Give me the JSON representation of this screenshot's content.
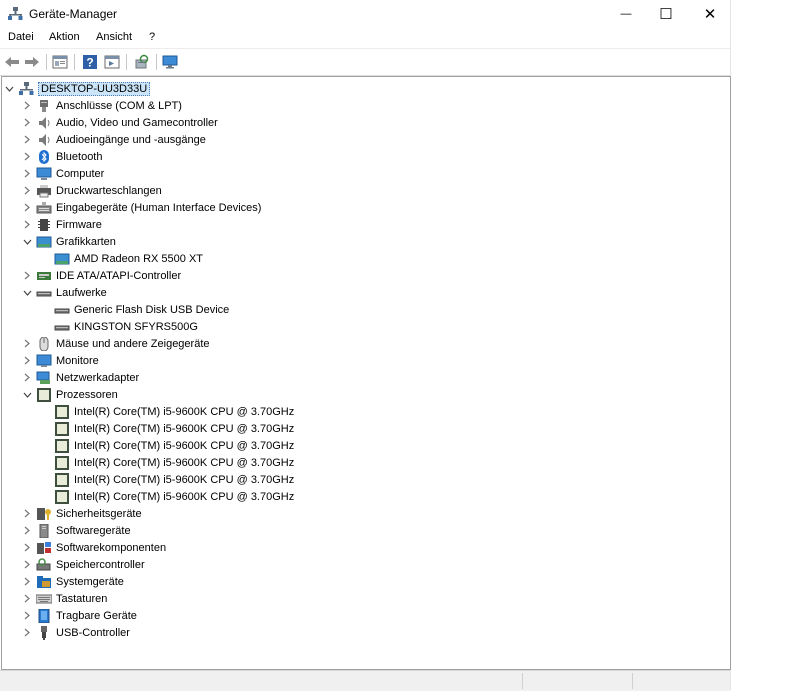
{
  "window": {
    "title": "Geräte-Manager",
    "minimize_glyph": "—",
    "maximize_glyph": "☐",
    "close_glyph": "✕"
  },
  "menu": [
    "Datei",
    "Aktion",
    "Ansicht",
    "?"
  ],
  "toolbar": [
    "back-arrow-icon",
    "forward-arrow-icon",
    "properties-icon",
    "help-icon",
    "view-icon",
    "scan-hardware-icon",
    "monitor-icon"
  ],
  "tree": {
    "root": "DESKTOP-UU3D33U",
    "categories": [
      {
        "label": "Anschlüsse (COM & LPT)",
        "icon": "port-icon",
        "expanded": false
      },
      {
        "label": "Audio, Video und Gamecontroller",
        "icon": "speaker-icon",
        "expanded": false
      },
      {
        "label": "Audioeingänge und -ausgänge",
        "icon": "speaker-icon",
        "expanded": false
      },
      {
        "label": "Bluetooth",
        "icon": "bluetooth-icon",
        "expanded": false
      },
      {
        "label": "Computer",
        "icon": "computer-icon",
        "expanded": false
      },
      {
        "label": "Druckwarteschlangen",
        "icon": "printer-icon",
        "expanded": false
      },
      {
        "label": "Eingabegeräte (Human Interface Devices)",
        "icon": "hid-icon",
        "expanded": false
      },
      {
        "label": "Firmware",
        "icon": "firmware-icon",
        "expanded": false
      },
      {
        "label": "Grafikkarten",
        "icon": "display-adapter-icon",
        "expanded": true,
        "children": [
          "AMD Radeon RX 5500 XT"
        ]
      },
      {
        "label": "IDE ATA/ATAPI-Controller",
        "icon": "ide-controller-icon",
        "expanded": false
      },
      {
        "label": "Laufwerke",
        "icon": "drive-icon",
        "expanded": true,
        "children": [
          "Generic Flash Disk USB Device",
          "KINGSTON SFYRS500G"
        ]
      },
      {
        "label": "Mäuse und andere Zeigegeräte",
        "icon": "mouse-icon",
        "expanded": false
      },
      {
        "label": "Monitore",
        "icon": "monitor-icon",
        "expanded": false
      },
      {
        "label": "Netzwerkadapter",
        "icon": "network-adapter-icon",
        "expanded": false
      },
      {
        "label": "Prozessoren",
        "icon": "cpu-icon",
        "expanded": true,
        "children": [
          "Intel(R) Core(TM) i5-9600K CPU @ 3.70GHz",
          "Intel(R) Core(TM) i5-9600K CPU @ 3.70GHz",
          "Intel(R) Core(TM) i5-9600K CPU @ 3.70GHz",
          "Intel(R) Core(TM) i5-9600K CPU @ 3.70GHz",
          "Intel(R) Core(TM) i5-9600K CPU @ 3.70GHz",
          "Intel(R) Core(TM) i5-9600K CPU @ 3.70GHz"
        ]
      },
      {
        "label": "Sicherheitsgeräte",
        "icon": "security-key-icon",
        "expanded": false
      },
      {
        "label": "Softwaregeräte",
        "icon": "software-device-icon",
        "expanded": false
      },
      {
        "label": "Softwarekomponenten",
        "icon": "software-component-icon",
        "expanded": false
      },
      {
        "label": "Speichercontroller",
        "icon": "storage-controller-icon",
        "expanded": false
      },
      {
        "label": "Systemgeräte",
        "icon": "system-folder-icon",
        "expanded": false
      },
      {
        "label": "Tastaturen",
        "icon": "keyboard-icon",
        "expanded": false
      },
      {
        "label": "Tragbare Geräte",
        "icon": "portable-device-icon",
        "expanded": false
      },
      {
        "label": "USB-Controller",
        "icon": "usb-icon",
        "expanded": false
      }
    ]
  }
}
